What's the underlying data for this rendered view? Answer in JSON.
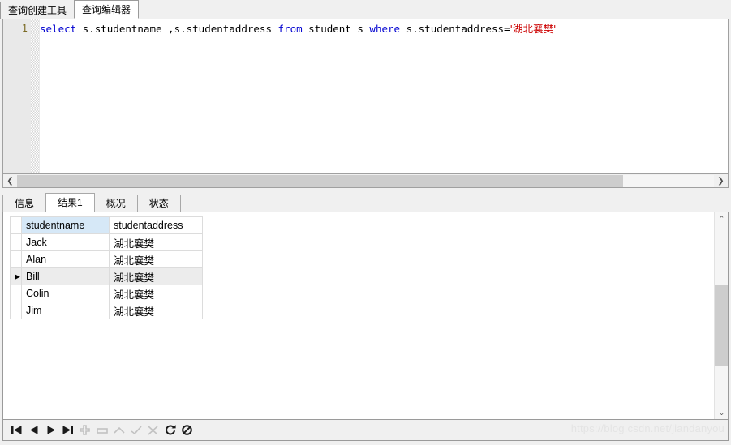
{
  "window": {
    "top_tabs": [
      {
        "label": "查询创建工具",
        "active": false
      },
      {
        "label": "查询编辑器",
        "active": true
      }
    ]
  },
  "editor": {
    "line_number": "1",
    "sql_tokens": [
      {
        "text": "select",
        "type": "keyword"
      },
      {
        "text": " s.studentname ,s.studentaddress ",
        "type": "plain"
      },
      {
        "text": "from",
        "type": "keyword"
      },
      {
        "text": " student s ",
        "type": "plain"
      },
      {
        "text": "where",
        "type": "keyword"
      },
      {
        "text": " s.studentaddress=",
        "type": "plain"
      },
      {
        "text": "'湖北襄樊'",
        "type": "string"
      }
    ],
    "full_sql": "select s.studentname ,s.studentaddress from student s where s.studentaddress='湖北襄樊'",
    "hscroll": {
      "left_arrow": "❮",
      "right_arrow": "❯",
      "thumb_percent": 87
    }
  },
  "result_tabs": [
    {
      "label": "信息",
      "active": false
    },
    {
      "label": "结果1",
      "active": true
    },
    {
      "label": "概况",
      "active": false
    },
    {
      "label": "状态",
      "active": false
    }
  ],
  "grid": {
    "columns": [
      "studentname",
      "studentaddress"
    ],
    "selected_column": "studentname",
    "selected_row_index": 2,
    "row_indicator": "▶",
    "rows": [
      {
        "studentname": "Jack",
        "studentaddress": "湖北襄樊"
      },
      {
        "studentname": "Alan",
        "studentaddress": "湖北襄樊"
      },
      {
        "studentname": "Bill",
        "studentaddress": "湖北襄樊"
      },
      {
        "studentname": "Colin",
        "studentaddress": "湖北襄樊"
      },
      {
        "studentname": "Jim",
        "studentaddress": "湖北襄樊"
      }
    ],
    "vscroll": {
      "up_arrow": "⌃",
      "down_arrow": "⌄"
    }
  },
  "nav_toolbar": {
    "buttons": [
      {
        "name": "first-record",
        "icon": "first",
        "enabled": true
      },
      {
        "name": "prev-record",
        "icon": "prev",
        "enabled": true
      },
      {
        "name": "next-record",
        "icon": "next",
        "enabled": true
      },
      {
        "name": "last-record",
        "icon": "last",
        "enabled": true
      },
      {
        "name": "add-record",
        "icon": "plus",
        "enabled": false
      },
      {
        "name": "delete-record",
        "icon": "minus",
        "enabled": false
      },
      {
        "name": "edit-record",
        "icon": "caret",
        "enabled": false
      },
      {
        "name": "confirm-edit",
        "icon": "check",
        "enabled": false
      },
      {
        "name": "cancel-edit",
        "icon": "cross",
        "enabled": false
      },
      {
        "name": "refresh",
        "icon": "refresh",
        "enabled": true
      },
      {
        "name": "stop",
        "icon": "stop",
        "enabled": true
      }
    ]
  },
  "watermark": {
    "text": "https://blog.csdn.net/jiandanyou"
  },
  "colors": {
    "keyword": "#0000d0",
    "string": "#cc0000",
    "header_selected": "#d6e8f7",
    "row_selected": "#ececec",
    "chrome": "#f0f0f0"
  }
}
